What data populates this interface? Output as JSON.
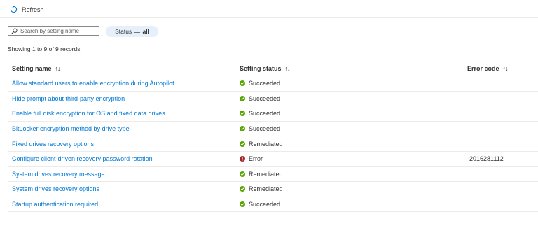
{
  "toolbar": {
    "refresh_label": "Refresh"
  },
  "search": {
    "placeholder": "Search by setting name",
    "value": ""
  },
  "filter": {
    "label": "Status ==",
    "value": "all"
  },
  "record_count": "Showing 1 to 9 of 9 records",
  "table": {
    "columns": [
      "Setting name",
      "Setting status",
      "Error code"
    ],
    "sort_glyph": "↑↓",
    "rows": [
      {
        "name": "Allow standard users to enable encryption during Autopilot",
        "status": "Succeeded",
        "error": ""
      },
      {
        "name": "Hide prompt about third-party encryption",
        "status": "Succeeded",
        "error": ""
      },
      {
        "name": "Enable full disk encryption for OS and fixed data drives",
        "status": "Succeeded",
        "error": ""
      },
      {
        "name": "BitLocker encryption method by drive type",
        "status": "Succeeded",
        "error": ""
      },
      {
        "name": "Fixed drives recovery options",
        "status": "Remediated",
        "error": ""
      },
      {
        "name": "Configure client-driven recovery password rotation",
        "status": "Error",
        "error": "-2016281112"
      },
      {
        "name": "System drives recovery message",
        "status": "Remediated",
        "error": ""
      },
      {
        "name": "System drives recovery options",
        "status": "Remediated",
        "error": ""
      },
      {
        "name": "Startup authentication required",
        "status": "Succeeded",
        "error": ""
      }
    ]
  },
  "colors": {
    "link": "#0078d4",
    "success": "#57a300",
    "error": "#a4262c",
    "filter_bg": "#e6f0fa"
  },
  "icons": {
    "refresh": "refresh-icon",
    "search": "search-icon",
    "success": "checkmark-circle-icon",
    "error": "error-circle-icon"
  }
}
